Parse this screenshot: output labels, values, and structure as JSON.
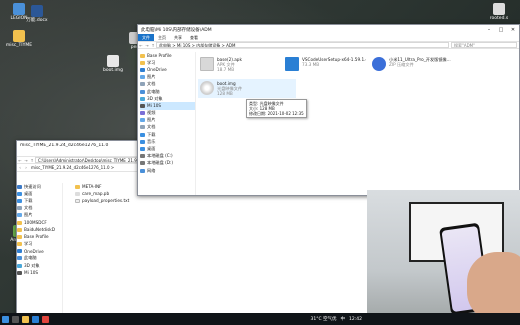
{
  "desktop": {
    "icons": [
      {
        "label": "LEGION",
        "color": "#4a90d9"
      },
      {
        "label": "万能.docx",
        "color": "#2b5797"
      },
      {
        "label": "misc_TIYME",
        "color": "#f2c14e"
      },
      {
        "label": "pen",
        "color": "#cccccc"
      },
      {
        "label": "boot.img",
        "color": "#e8e8e8"
      },
      {
        "label": "rooted.s",
        "color": "#dddddd"
      },
      {
        "label": "Android",
        "color": "#6ab04c"
      }
    ]
  },
  "back_window": {
    "title": "misc_TIYME_21.9.24_d2c46e1276_11.0",
    "address": "C:\\Users\\Administrator\\Desktop\\misc_TIYME_21.9.24_d2c46e1276_11.0",
    "breadcrumb_tail": "misc_TIYME_21.9.24_d2c46e1276_11.0 >",
    "sidebar": [
      {
        "label": "快速访问",
        "color": "#3d7ac6"
      },
      {
        "label": "桌面",
        "color": "#3b8fe0"
      },
      {
        "label": "下载",
        "color": "#3b8fe0"
      },
      {
        "label": "文档",
        "color": "#8fa3b8"
      },
      {
        "label": "图片",
        "color": "#64a8e8"
      },
      {
        "label": "100MSDCF",
        "color": "#f2c14e"
      },
      {
        "label": "BaiduNetdiskD",
        "color": "#f2c14e"
      },
      {
        "label": "Base Profile",
        "color": "#f2c14e"
      },
      {
        "label": "学习",
        "color": "#f2c14e"
      },
      {
        "label": "OneDrive",
        "color": "#2f7fd3"
      },
      {
        "label": "此电脑",
        "color": "#4a90d9"
      },
      {
        "label": "3D 对象",
        "color": "#4aa8d9"
      },
      {
        "label": "Mi 10S",
        "color": "#555555"
      }
    ],
    "files": [
      "META-INF",
      "care_map.pb",
      "payload_properties.txt"
    ]
  },
  "front_window": {
    "title": "此电脑\\Mi 10S\\内部存储设备\\ADM",
    "ribbon": {
      "file": "文件",
      "tabs": [
        "主页",
        "共享",
        "查看"
      ]
    },
    "address": "此电脑 > Mi 10S > 内部存储设备 > ADM",
    "search_placeholder": "搜索\"ADM\"",
    "sidebar": [
      {
        "label": "Base Profile",
        "color": "#f2c14e"
      },
      {
        "label": "学习",
        "color": "#f2c14e"
      },
      {
        "label": "OneDrive",
        "color": "#2f7fd3"
      },
      {
        "label": "图片",
        "color": "#64a8e8"
      },
      {
        "label": "文档",
        "color": "#8fa3b8"
      },
      {
        "label": "此电脑",
        "color": "#4a90d9"
      },
      {
        "label": "3D 对象",
        "color": "#4aa8d9"
      },
      {
        "label": "Mi 10S",
        "color": "#555555"
      },
      {
        "label": "视频",
        "color": "#7b6fd6"
      },
      {
        "label": "图片",
        "color": "#64a8e8"
      },
      {
        "label": "文档",
        "color": "#8fa3b8"
      },
      {
        "label": "下载",
        "color": "#3b8fe0"
      },
      {
        "label": "音乐",
        "color": "#3b8fe0"
      },
      {
        "label": "桌面",
        "color": "#3b8fe0"
      },
      {
        "label": "本地磁盘 (C:)",
        "color": "#777777"
      },
      {
        "label": "本地磁盘 (D:)",
        "color": "#777777"
      },
      {
        "label": "网络",
        "color": "#4a90d9"
      }
    ],
    "selected_sidebar": "Mi 10S",
    "files": [
      {
        "name": "base(2).apk",
        "type": "APK 文件",
        "size": "18.7 MB",
        "color": "#d8d8d8"
      },
      {
        "name": "VSCodeUserSetup-x64-1.59.1.exe",
        "type": "",
        "size": "73.3 MB",
        "color": "#2a7fd4"
      },
      {
        "name": "小米11_Ultra_Pro_开发版镜像...",
        "type": "ZIP 压缩文件",
        "size": "",
        "color": "#3b6fd9"
      },
      {
        "name": "boot.img",
        "type": "光盘映像文件",
        "size": "128 MB",
        "color": "#e2e2e2"
      }
    ],
    "tooltip": {
      "line1": "类型: 光盘映像文件",
      "line2": "大小: 128 MB",
      "line3": "修改日期: 2021-10-02 12:35"
    }
  },
  "taskbar": {
    "weather": "31°C 空气优",
    "time": "12:42",
    "ime": "中"
  }
}
